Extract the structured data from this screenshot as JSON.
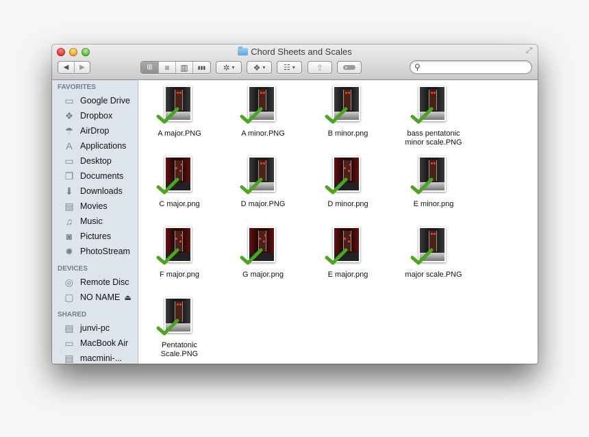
{
  "window": {
    "title": "Chord Sheets and Scales",
    "title_icon": "folder-icon",
    "controls": [
      "close",
      "minimize",
      "zoom"
    ],
    "fullscreen_icon": "fullscreen-arrows-icon"
  },
  "toolbar": {
    "nav": {
      "back": "◀",
      "forward": "▶"
    },
    "view_modes": [
      {
        "name": "icon-view",
        "glyph": "⊞",
        "active": true
      },
      {
        "name": "list-view",
        "glyph": "≡",
        "active": false
      },
      {
        "name": "column-view",
        "glyph": "▥",
        "active": false
      },
      {
        "name": "coverflow-view",
        "glyph": "▮▮▮",
        "active": false
      }
    ],
    "action": {
      "glyph": "✲",
      "caret": "▾"
    },
    "dropbox": {
      "glyph": "❖",
      "caret": "▾"
    },
    "arrange": {
      "glyph": "☷",
      "caret": "▾"
    },
    "share": {
      "glyph": "⇪"
    },
    "tags": {
      "glyph": "●"
    },
    "search": {
      "placeholder": "",
      "value": "",
      "icon": "🔍"
    }
  },
  "sidebar": {
    "sections": [
      {
        "heading": "FAVORITES",
        "items": [
          {
            "label": "Google Drive",
            "icon": "folder-icon",
            "glyph": "▭"
          },
          {
            "label": "Dropbox",
            "icon": "dropbox-icon",
            "glyph": "❖"
          },
          {
            "label": "AirDrop",
            "icon": "airdrop-icon",
            "glyph": "☂"
          },
          {
            "label": "Applications",
            "icon": "applications-icon",
            "glyph": "A"
          },
          {
            "label": "Desktop",
            "icon": "desktop-icon",
            "glyph": "▭"
          },
          {
            "label": "Documents",
            "icon": "documents-icon",
            "glyph": "❐"
          },
          {
            "label": "Downloads",
            "icon": "downloads-icon",
            "glyph": "⬇"
          },
          {
            "label": "Movies",
            "icon": "movies-icon",
            "glyph": "▤"
          },
          {
            "label": "Music",
            "icon": "music-icon",
            "glyph": "♫"
          },
          {
            "label": "Pictures",
            "icon": "pictures-icon",
            "glyph": "◙"
          },
          {
            "label": "PhotoStream",
            "icon": "photostream-icon",
            "glyph": "✹"
          }
        ]
      },
      {
        "heading": "DEVICES",
        "items": [
          {
            "label": "Remote Disc",
            "icon": "disc-icon",
            "glyph": "◎"
          },
          {
            "label": "NO NAME",
            "icon": "drive-icon",
            "glyph": "▢",
            "eject": "⏏"
          }
        ]
      },
      {
        "heading": "SHARED",
        "items": [
          {
            "label": "junvi-pc",
            "icon": "pc-icon",
            "glyph": "▤"
          },
          {
            "label": "MacBook Air",
            "icon": "laptop-icon",
            "glyph": "▭"
          },
          {
            "label": "macmini-...",
            "icon": "server-icon",
            "glyph": "▤"
          }
        ]
      }
    ]
  },
  "files": [
    {
      "name": "A major.PNG",
      "theme": "dark",
      "synced": true
    },
    {
      "name": "A minor.PNG",
      "theme": "dark",
      "synced": true
    },
    {
      "name": "B minor.png",
      "theme": "dark",
      "synced": true
    },
    {
      "name": "bass pentatonic minor scale.PNG",
      "theme": "dark",
      "synced": true
    },
    {
      "name": "C major.png",
      "theme": "red",
      "synced": true
    },
    {
      "name": "D major.PNG",
      "theme": "dark",
      "synced": true
    },
    {
      "name": "D minor.png",
      "theme": "red",
      "synced": true
    },
    {
      "name": "E minor.png",
      "theme": "dark",
      "synced": true
    },
    {
      "name": "F major.png",
      "theme": "red",
      "synced": true
    },
    {
      "name": "G major.png",
      "theme": "red",
      "synced": true
    },
    {
      "name": "E major.png",
      "theme": "red",
      "synced": true
    },
    {
      "name": "major scale.PNG",
      "theme": "dark",
      "synced": true
    },
    {
      "name": "Pentatonic Scale.PNG",
      "theme": "dark",
      "synced": true
    }
  ],
  "colors": {
    "sync_check": "#4aa51f",
    "sidebar_bg": "#dde4ec",
    "sidebar_heading": "#6f7d8c"
  }
}
